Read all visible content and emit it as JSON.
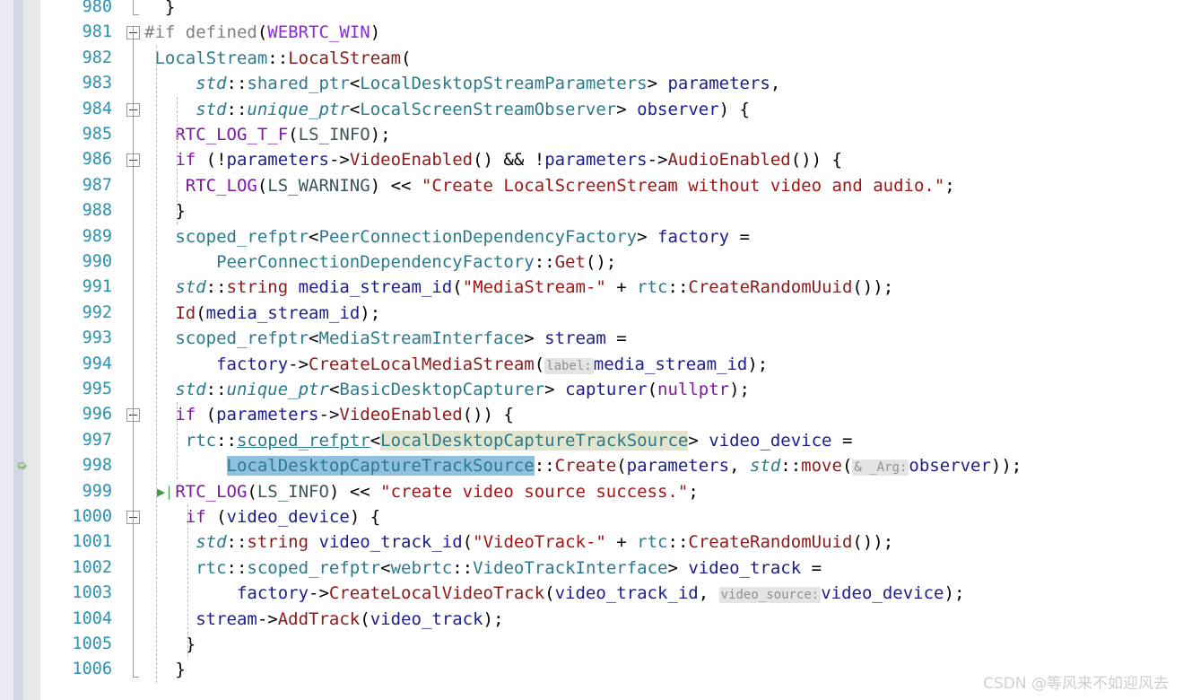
{
  "editor": {
    "language": "cpp",
    "watermark": "CSDN @等风来不如迎风去",
    "colors": {
      "background": "#ffffff",
      "line_number": "#2b91af",
      "gutter_lavender": "#eaeaf2",
      "gutter_stripe": "#d3d7e3",
      "gutter_annotation": "#e6e7e9",
      "keyword": "#7f19a2",
      "type": "#2b7a8c",
      "function": "#8b1a1a",
      "string": "#a31515",
      "variable": "#1c1c8b",
      "preprocessor": "#808080",
      "preprocessor_id": "#8b2ad6",
      "hint_background": "#e4e4e4",
      "hint_text": "#909090",
      "occurrence_highlight": "#e2e4cd",
      "selection_highlight": "#8fc0dd",
      "marker_green": "#3f9a3f",
      "bookmark_green": "#8fbc79"
    },
    "markers": {
      "bookmark_arrow_line": 998,
      "bookmark_arrow_glyph": "➭",
      "run_to_cursor_line": 999,
      "run_to_cursor_glyph": "▶|"
    },
    "first_line_number": 980,
    "last_line_number": 1006,
    "line_numbers": [
      980,
      981,
      982,
      983,
      984,
      985,
      986,
      987,
      988,
      989,
      990,
      991,
      992,
      993,
      994,
      995,
      996,
      997,
      998,
      999,
      1000,
      1001,
      1002,
      1003,
      1004,
      1005,
      1006
    ],
    "lines": [
      {
        "number": 980,
        "fold": "endcap",
        "tokens": [
          {
            "text": "  }",
            "cls": "t-plain"
          }
        ]
      },
      {
        "number": 981,
        "fold": "box",
        "tokens": [
          {
            "text": "#if defined",
            "cls": "t-pp"
          },
          {
            "text": "(",
            "cls": "t-plain"
          },
          {
            "text": "WEBRTC_WIN",
            "cls": "t-ppid"
          },
          {
            "text": ")",
            "cls": "t-plain"
          }
        ]
      },
      {
        "number": 982,
        "fold": "none",
        "tokens": [
          {
            "text": " ",
            "cls": "t-plain"
          },
          {
            "text": "LocalStream",
            "cls": "t-type"
          },
          {
            "text": "::",
            "cls": "t-plain"
          },
          {
            "text": "LocalStream",
            "cls": "t-fn"
          },
          {
            "text": "(",
            "cls": "t-plain"
          }
        ]
      },
      {
        "number": 983,
        "fold": "none",
        "tokens": [
          {
            "text": "     ",
            "cls": "t-plain"
          },
          {
            "text": "std",
            "cls": "t-typeit"
          },
          {
            "text": "::",
            "cls": "t-plain"
          },
          {
            "text": "shared_ptr",
            "cls": "t-type"
          },
          {
            "text": "<",
            "cls": "t-plain"
          },
          {
            "text": "LocalDesktopStreamParameters",
            "cls": "t-type"
          },
          {
            "text": "> ",
            "cls": "t-plain"
          },
          {
            "text": "parameters",
            "cls": "t-var"
          },
          {
            "text": ",",
            "cls": "t-plain"
          }
        ]
      },
      {
        "number": 984,
        "fold": "box",
        "tokens": [
          {
            "text": "     ",
            "cls": "t-plain"
          },
          {
            "text": "std",
            "cls": "t-typeit"
          },
          {
            "text": "::",
            "cls": "t-plain"
          },
          {
            "text": "unique_ptr",
            "cls": "t-typeit"
          },
          {
            "text": "<",
            "cls": "t-plain"
          },
          {
            "text": "LocalScreenStreamObserver",
            "cls": "t-type"
          },
          {
            "text": "> ",
            "cls": "t-plain"
          },
          {
            "text": "observer",
            "cls": "t-var"
          },
          {
            "text": ") {",
            "cls": "t-plain"
          }
        ]
      },
      {
        "number": 985,
        "fold": "none",
        "tokens": [
          {
            "text": "   ",
            "cls": "t-plain"
          },
          {
            "text": "RTC_LOG_T_F",
            "cls": "t-macro"
          },
          {
            "text": "(",
            "cls": "t-plain"
          },
          {
            "text": "LS_INFO",
            "cls": "t-enum"
          },
          {
            "text": ");",
            "cls": "t-plain"
          }
        ]
      },
      {
        "number": 986,
        "fold": "box",
        "tokens": [
          {
            "text": "   ",
            "cls": "t-plain"
          },
          {
            "text": "if",
            "cls": "t-kw"
          },
          {
            "text": " (!",
            "cls": "t-plain"
          },
          {
            "text": "parameters",
            "cls": "t-var"
          },
          {
            "text": "->",
            "cls": "t-plain"
          },
          {
            "text": "VideoEnabled",
            "cls": "t-fn"
          },
          {
            "text": "() && !",
            "cls": "t-plain"
          },
          {
            "text": "parameters",
            "cls": "t-var"
          },
          {
            "text": "->",
            "cls": "t-plain"
          },
          {
            "text": "AudioEnabled",
            "cls": "t-fn"
          },
          {
            "text": "()) {",
            "cls": "t-plain"
          }
        ]
      },
      {
        "number": 987,
        "fold": "none",
        "tokens": [
          {
            "text": "    ",
            "cls": "t-plain"
          },
          {
            "text": "RTC_LOG",
            "cls": "t-macro"
          },
          {
            "text": "(",
            "cls": "t-plain"
          },
          {
            "text": "LS_WARNING",
            "cls": "t-enum"
          },
          {
            "text": ") << ",
            "cls": "t-plain"
          },
          {
            "text": "\"Create LocalScreenStream without video and audio.\"",
            "cls": "t-str"
          },
          {
            "text": ";",
            "cls": "t-plain"
          }
        ]
      },
      {
        "number": 988,
        "fold": "none",
        "tokens": [
          {
            "text": "   }",
            "cls": "t-plain"
          }
        ]
      },
      {
        "number": 989,
        "fold": "none",
        "tokens": [
          {
            "text": "   ",
            "cls": "t-plain"
          },
          {
            "text": "scoped_refptr",
            "cls": "t-type"
          },
          {
            "text": "<",
            "cls": "t-plain"
          },
          {
            "text": "PeerConnectionDependencyFactory",
            "cls": "t-type"
          },
          {
            "text": "> ",
            "cls": "t-plain"
          },
          {
            "text": "factory",
            "cls": "t-var"
          },
          {
            "text": " =",
            "cls": "t-plain"
          }
        ]
      },
      {
        "number": 990,
        "fold": "none",
        "tokens": [
          {
            "text": "       ",
            "cls": "t-plain"
          },
          {
            "text": "PeerConnectionDependencyFactory",
            "cls": "t-type"
          },
          {
            "text": "::",
            "cls": "t-plain"
          },
          {
            "text": "Get",
            "cls": "t-fn"
          },
          {
            "text": "();",
            "cls": "t-plain"
          }
        ]
      },
      {
        "number": 991,
        "fold": "none",
        "tokens": [
          {
            "text": "   ",
            "cls": "t-plain"
          },
          {
            "text": "std",
            "cls": "t-typeit"
          },
          {
            "text": "::",
            "cls": "t-plain"
          },
          {
            "text": "string",
            "cls": "t-fn"
          },
          {
            "text": " ",
            "cls": "t-plain"
          },
          {
            "text": "media_stream_id",
            "cls": "t-var"
          },
          {
            "text": "(",
            "cls": "t-plain"
          },
          {
            "text": "\"MediaStream-\"",
            "cls": "t-str"
          },
          {
            "text": " + ",
            "cls": "t-plain"
          },
          {
            "text": "rtc",
            "cls": "t-type"
          },
          {
            "text": "::",
            "cls": "t-plain"
          },
          {
            "text": "CreateRandomUuid",
            "cls": "t-fn"
          },
          {
            "text": "());",
            "cls": "t-plain"
          }
        ]
      },
      {
        "number": 992,
        "fold": "none",
        "tokens": [
          {
            "text": "   ",
            "cls": "t-plain"
          },
          {
            "text": "Id",
            "cls": "t-fn"
          },
          {
            "text": "(",
            "cls": "t-plain"
          },
          {
            "text": "media_stream_id",
            "cls": "t-var"
          },
          {
            "text": ");",
            "cls": "t-plain"
          }
        ]
      },
      {
        "number": 993,
        "fold": "none",
        "tokens": [
          {
            "text": "   ",
            "cls": "t-plain"
          },
          {
            "text": "scoped_refptr",
            "cls": "t-type"
          },
          {
            "text": "<",
            "cls": "t-plain"
          },
          {
            "text": "MediaStreamInterface",
            "cls": "t-type"
          },
          {
            "text": "> ",
            "cls": "t-plain"
          },
          {
            "text": "stream",
            "cls": "t-var"
          },
          {
            "text": " =",
            "cls": "t-plain"
          }
        ]
      },
      {
        "number": 994,
        "fold": "none",
        "tokens": [
          {
            "text": "       ",
            "cls": "t-plain"
          },
          {
            "text": "factory",
            "cls": "t-var"
          },
          {
            "text": "->",
            "cls": "t-plain"
          },
          {
            "text": "CreateLocalMediaStream",
            "cls": "t-fn"
          },
          {
            "text": "(",
            "cls": "t-plain"
          },
          {
            "text": "label:",
            "cls": "hint"
          },
          {
            "text": "media_stream_id",
            "cls": "t-var"
          },
          {
            "text": ");",
            "cls": "t-plain"
          }
        ]
      },
      {
        "number": 995,
        "fold": "none",
        "tokens": [
          {
            "text": "   ",
            "cls": "t-plain"
          },
          {
            "text": "std",
            "cls": "t-typeit"
          },
          {
            "text": "::",
            "cls": "t-plain"
          },
          {
            "text": "unique_ptr",
            "cls": "t-typeit"
          },
          {
            "text": "<",
            "cls": "t-plain"
          },
          {
            "text": "BasicDesktopCapturer",
            "cls": "t-type"
          },
          {
            "text": "> ",
            "cls": "t-plain"
          },
          {
            "text": "capturer",
            "cls": "t-var"
          },
          {
            "text": "(",
            "cls": "t-plain"
          },
          {
            "text": "nullptr",
            "cls": "t-kw"
          },
          {
            "text": ");",
            "cls": "t-plain"
          }
        ]
      },
      {
        "number": 996,
        "fold": "box",
        "tokens": [
          {
            "text": "   ",
            "cls": "t-plain"
          },
          {
            "text": "if",
            "cls": "t-kw"
          },
          {
            "text": " (",
            "cls": "t-plain"
          },
          {
            "text": "parameters",
            "cls": "t-var"
          },
          {
            "text": "->",
            "cls": "t-plain"
          },
          {
            "text": "VideoEnabled",
            "cls": "t-fn"
          },
          {
            "text": "()) {",
            "cls": "t-plain"
          }
        ]
      },
      {
        "number": 997,
        "fold": "none",
        "tokens": [
          {
            "text": "    ",
            "cls": "t-plain"
          },
          {
            "text": "rtc",
            "cls": "t-type"
          },
          {
            "text": "::",
            "cls": "t-plain"
          },
          {
            "text": "scoped_refptr",
            "cls": "t-type t-under"
          },
          {
            "text": "<",
            "cls": "t-plain"
          },
          {
            "text": "LocalDesktopCaptureTrackSource",
            "cls": "t-type hl-occurrence"
          },
          {
            "text": "> ",
            "cls": "t-plain"
          },
          {
            "text": "video_device",
            "cls": "t-var"
          },
          {
            "text": " =",
            "cls": "t-plain"
          }
        ]
      },
      {
        "number": 998,
        "fold": "none",
        "tokens": [
          {
            "text": "        ",
            "cls": "t-plain"
          },
          {
            "text": "LocalDesktopCaptureTrackSource",
            "cls": "t-type hl-selection"
          },
          {
            "text": "::",
            "cls": "t-plain"
          },
          {
            "text": "Create",
            "cls": "t-fn"
          },
          {
            "text": "(",
            "cls": "t-plain"
          },
          {
            "text": "parameters",
            "cls": "t-var"
          },
          {
            "text": ", ",
            "cls": "t-plain"
          },
          {
            "text": "std",
            "cls": "t-typeit"
          },
          {
            "text": "::",
            "cls": "t-plain"
          },
          {
            "text": "move",
            "cls": "t-fn"
          },
          {
            "text": "(",
            "cls": "t-plain"
          },
          {
            "text": "& _Arg:",
            "cls": "hint"
          },
          {
            "text": "observer",
            "cls": "t-var"
          },
          {
            "text": "));",
            "cls": "t-plain"
          }
        ]
      },
      {
        "number": 999,
        "fold": "none",
        "tokens": [
          {
            "text": "   ",
            "cls": "t-plain"
          },
          {
            "text": "RTC_LOG",
            "cls": "t-macro"
          },
          {
            "text": "(",
            "cls": "t-plain"
          },
          {
            "text": "LS_INFO",
            "cls": "t-enum"
          },
          {
            "text": ") << ",
            "cls": "t-plain"
          },
          {
            "text": "\"create video source success.\"",
            "cls": "t-str"
          },
          {
            "text": ";",
            "cls": "t-plain"
          }
        ]
      },
      {
        "number": 1000,
        "fold": "box",
        "tokens": [
          {
            "text": "    ",
            "cls": "t-plain"
          },
          {
            "text": "if",
            "cls": "t-kw"
          },
          {
            "text": " (",
            "cls": "t-plain"
          },
          {
            "text": "video_device",
            "cls": "t-var"
          },
          {
            "text": ") {",
            "cls": "t-plain"
          }
        ]
      },
      {
        "number": 1001,
        "fold": "none",
        "tokens": [
          {
            "text": "     ",
            "cls": "t-plain"
          },
          {
            "text": "std",
            "cls": "t-typeit"
          },
          {
            "text": "::",
            "cls": "t-plain"
          },
          {
            "text": "string",
            "cls": "t-fn"
          },
          {
            "text": " ",
            "cls": "t-plain"
          },
          {
            "text": "video_track_id",
            "cls": "t-var"
          },
          {
            "text": "(",
            "cls": "t-plain"
          },
          {
            "text": "\"VideoTrack-\"",
            "cls": "t-str"
          },
          {
            "text": " + ",
            "cls": "t-plain"
          },
          {
            "text": "rtc",
            "cls": "t-type"
          },
          {
            "text": "::",
            "cls": "t-plain"
          },
          {
            "text": "CreateRandomUuid",
            "cls": "t-fn"
          },
          {
            "text": "());",
            "cls": "t-plain"
          }
        ]
      },
      {
        "number": 1002,
        "fold": "none",
        "tokens": [
          {
            "text": "     ",
            "cls": "t-plain"
          },
          {
            "text": "rtc",
            "cls": "t-type"
          },
          {
            "text": "::",
            "cls": "t-plain"
          },
          {
            "text": "scoped_refptr",
            "cls": "t-type"
          },
          {
            "text": "<",
            "cls": "t-plain"
          },
          {
            "text": "webrtc",
            "cls": "t-type"
          },
          {
            "text": "::",
            "cls": "t-plain"
          },
          {
            "text": "VideoTrackInterface",
            "cls": "t-type"
          },
          {
            "text": "> ",
            "cls": "t-plain"
          },
          {
            "text": "video_track",
            "cls": "t-var"
          },
          {
            "text": " =",
            "cls": "t-plain"
          }
        ]
      },
      {
        "number": 1003,
        "fold": "none",
        "tokens": [
          {
            "text": "         ",
            "cls": "t-plain"
          },
          {
            "text": "factory",
            "cls": "t-var"
          },
          {
            "text": "->",
            "cls": "t-plain"
          },
          {
            "text": "CreateLocalVideoTrack",
            "cls": "t-fn"
          },
          {
            "text": "(",
            "cls": "t-plain"
          },
          {
            "text": "video_track_id",
            "cls": "t-var"
          },
          {
            "text": ", ",
            "cls": "t-plain"
          },
          {
            "text": "video_source:",
            "cls": "hint"
          },
          {
            "text": "video_device",
            "cls": "t-var"
          },
          {
            "text": ");",
            "cls": "t-plain"
          }
        ]
      },
      {
        "number": 1004,
        "fold": "none",
        "tokens": [
          {
            "text": "     ",
            "cls": "t-plain"
          },
          {
            "text": "stream",
            "cls": "t-var"
          },
          {
            "text": "->",
            "cls": "t-plain"
          },
          {
            "text": "AddTrack",
            "cls": "t-fn"
          },
          {
            "text": "(",
            "cls": "t-plain"
          },
          {
            "text": "video_track",
            "cls": "t-var"
          },
          {
            "text": ");",
            "cls": "t-plain"
          }
        ]
      },
      {
        "number": 1005,
        "fold": "none",
        "tokens": [
          {
            "text": "    }",
            "cls": "t-plain"
          }
        ]
      },
      {
        "number": 1006,
        "fold": "endcap",
        "tokens": [
          {
            "text": "   }",
            "cls": "t-plain"
          }
        ]
      }
    ]
  }
}
